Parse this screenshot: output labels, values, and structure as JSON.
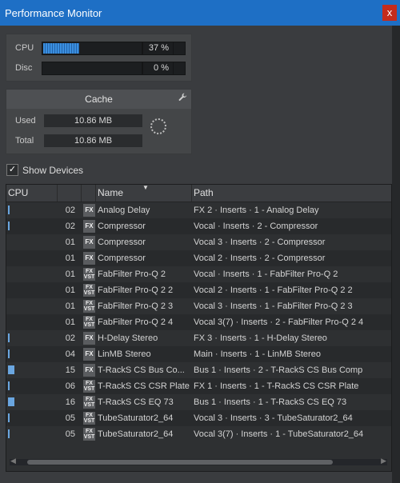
{
  "window": {
    "title": "Performance Monitor",
    "close_label": "x"
  },
  "meters": [
    {
      "label": "CPU",
      "value": "37 %",
      "fraction": 0.37
    },
    {
      "label": "Disc",
      "value": "0 %",
      "fraction": 0
    }
  ],
  "cache": {
    "title": "Cache",
    "used_label": "Used",
    "used_value": "10.86 MB",
    "total_label": "Total",
    "total_value": "10.86 MB"
  },
  "show_devices": {
    "label": "Show Devices",
    "checked": true
  },
  "table": {
    "columns": [
      "CPU",
      "",
      "Name",
      "Path"
    ],
    "rows": [
      {
        "count": "02",
        "fx": "FX",
        "name": "Analog Delay",
        "path": "FX 2 · Inserts · 1 - Analog Delay",
        "load": 0.02
      },
      {
        "count": "02",
        "fx": "FX",
        "name": "Compressor",
        "path": "Vocal · Inserts · 2 - Compressor",
        "load": 0.02
      },
      {
        "count": "01",
        "fx": "FX",
        "name": "Compressor",
        "path": "Vocal 3 · Inserts · 2 - Compressor",
        "load": 0
      },
      {
        "count": "01",
        "fx": "FX",
        "name": "Compressor",
        "path": "Vocal 2 · Inserts · 2 - Compressor",
        "load": 0
      },
      {
        "count": "01",
        "fx": "FX VST",
        "name": "FabFilter Pro-Q 2",
        "path": "Vocal · Inserts · 1 - FabFilter Pro-Q 2",
        "load": 0
      },
      {
        "count": "01",
        "fx": "FX VST",
        "name": "FabFilter Pro-Q 2 2",
        "path": "Vocal 2 · Inserts · 1 - FabFilter Pro-Q 2 2",
        "load": 0
      },
      {
        "count": "01",
        "fx": "FX VST",
        "name": "FabFilter Pro-Q 2 3",
        "path": "Vocal 3 · Inserts · 1 - FabFilter Pro-Q 2 3",
        "load": 0
      },
      {
        "count": "01",
        "fx": "FX VST",
        "name": "FabFilter Pro-Q 2 4",
        "path": "Vocal 3(7) · Inserts · 2 - FabFilter Pro-Q 2 4",
        "load": 0
      },
      {
        "count": "02",
        "fx": "FX",
        "name": "H-Delay Stereo",
        "path": "FX 3 · Inserts · 1 - H-Delay Stereo",
        "load": 0.02
      },
      {
        "count": "04",
        "fx": "FX",
        "name": "LinMB Stereo",
        "path": "Main · Inserts · 1 - LinMB Stereo",
        "load": 0.04
      },
      {
        "count": "15",
        "fx": "FX",
        "name": "T-RackS CS Bus Co...",
        "path": "Bus 1 · Inserts · 2 - T-RackS CS Bus Comp",
        "load": 0.15
      },
      {
        "count": "06",
        "fx": "FX VST",
        "name": "T-RackS CS CSR Plate",
        "path": "FX 1 · Inserts · 1 - T-RackS CS CSR Plate",
        "load": 0.06
      },
      {
        "count": "16",
        "fx": "FX VST",
        "name": "T-RackS CS EQ 73",
        "path": "Bus 1 · Inserts · 1 - T-RackS CS EQ 73",
        "load": 0.16
      },
      {
        "count": "05",
        "fx": "FX VST",
        "name": "TubeSaturator2_64",
        "path": "Vocal 3 · Inserts · 3 - TubeSaturator2_64",
        "load": 0.05
      },
      {
        "count": "05",
        "fx": "FX VST",
        "name": "TubeSaturator2_64",
        "path": "Vocal 3(7) · Inserts · 1 - TubeSaturator2_64",
        "load": 0.05
      }
    ]
  },
  "colors": {
    "titlebar": "#1e6fc5",
    "meter_fill": "#3a8fe0",
    "close": "#c42b1c"
  },
  "icons": {
    "close": "close-icon",
    "wrench": "wrench-icon",
    "spinner": "loading-spinner-icon",
    "sort": "sort-desc-icon"
  }
}
